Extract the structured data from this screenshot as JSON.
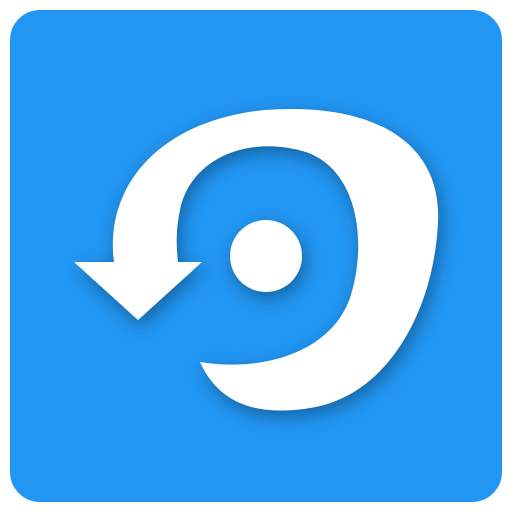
{
  "icon": {
    "name": "rotate-restore-app-icon",
    "background_color": "#2196F3",
    "glyph_color": "#FFFFFF",
    "shadow_color": "#0D47A1"
  }
}
